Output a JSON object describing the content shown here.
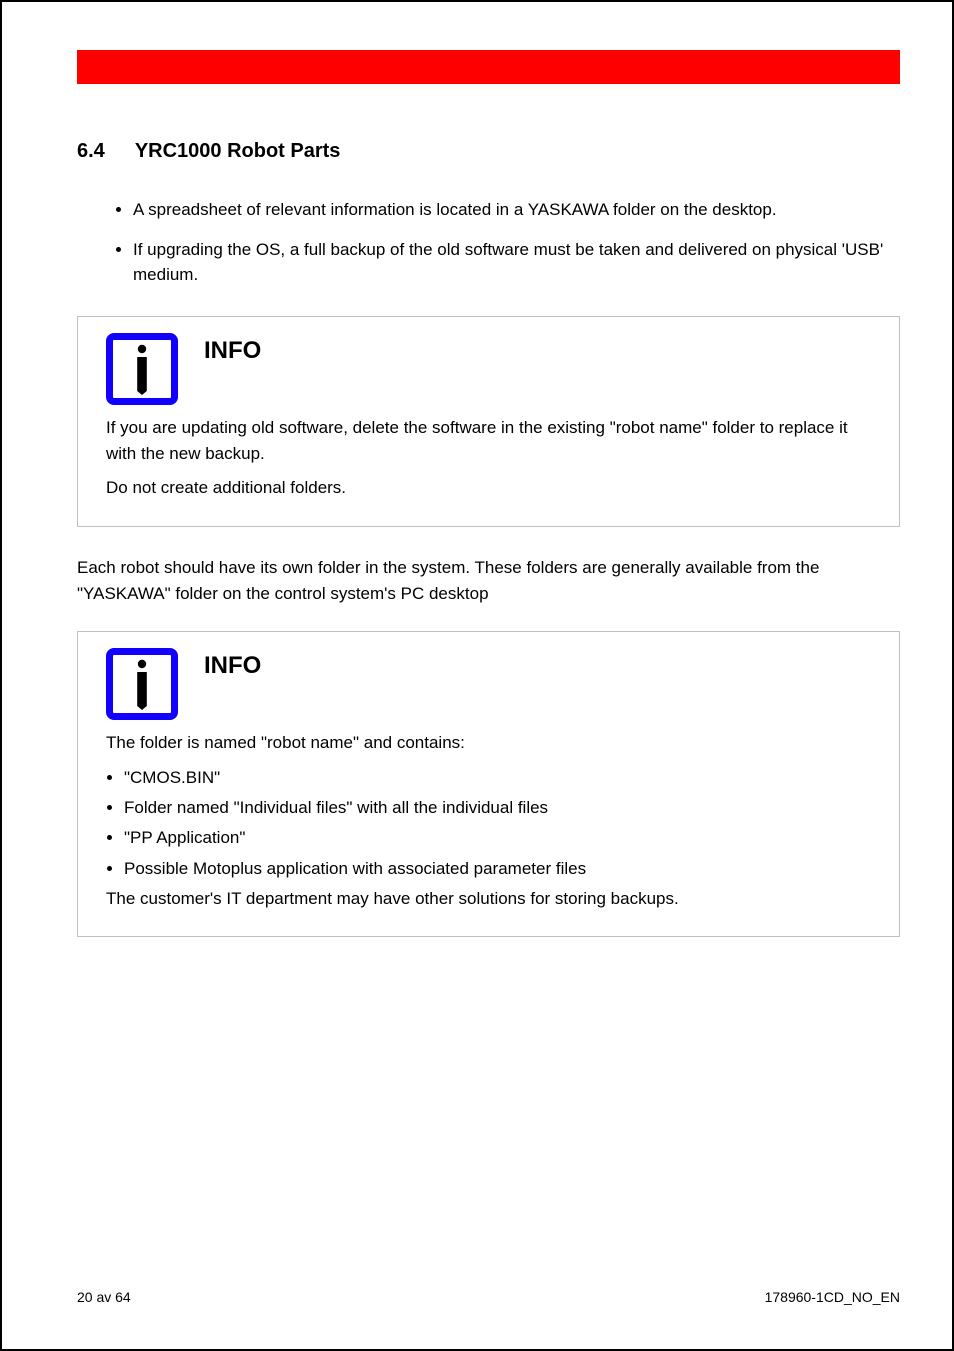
{
  "section": {
    "number": "6.4",
    "title": "YRC1000 Robot Parts"
  },
  "bullets": [
    "A spreadsheet of relevant information is located in a YASKAWA folder on the desktop.",
    "If upgrading the OS, a full backup of the old software must be taken and delivered on physical 'USB' medium."
  ],
  "infobox1": {
    "label": "INFO",
    "paragraphs": [
      "If you are updating old software, delete the software in the existing \"robot name\" folder to replace it with the new backup.",
      "Do not create additional folders."
    ]
  },
  "bodytext": "Each robot should have its own folder in the system. These folders are generally available from the \"YASKAWA\" folder on the control system's PC desktop",
  "infobox2": {
    "label": "INFO",
    "list_intro": "The folder is named \"robot name\" and contains:",
    "list": [
      "\"CMOS.BIN\"",
      "Folder named \"Individual files\" with all the individual files",
      "\"PP Application\"",
      "Possible Motoplus application with associated parameter files"
    ],
    "outro": "The customer's IT department may have other solutions for storing backups."
  },
  "footer": {
    "left": "20 av 64",
    "right": "178960-1CD_NO_EN"
  }
}
